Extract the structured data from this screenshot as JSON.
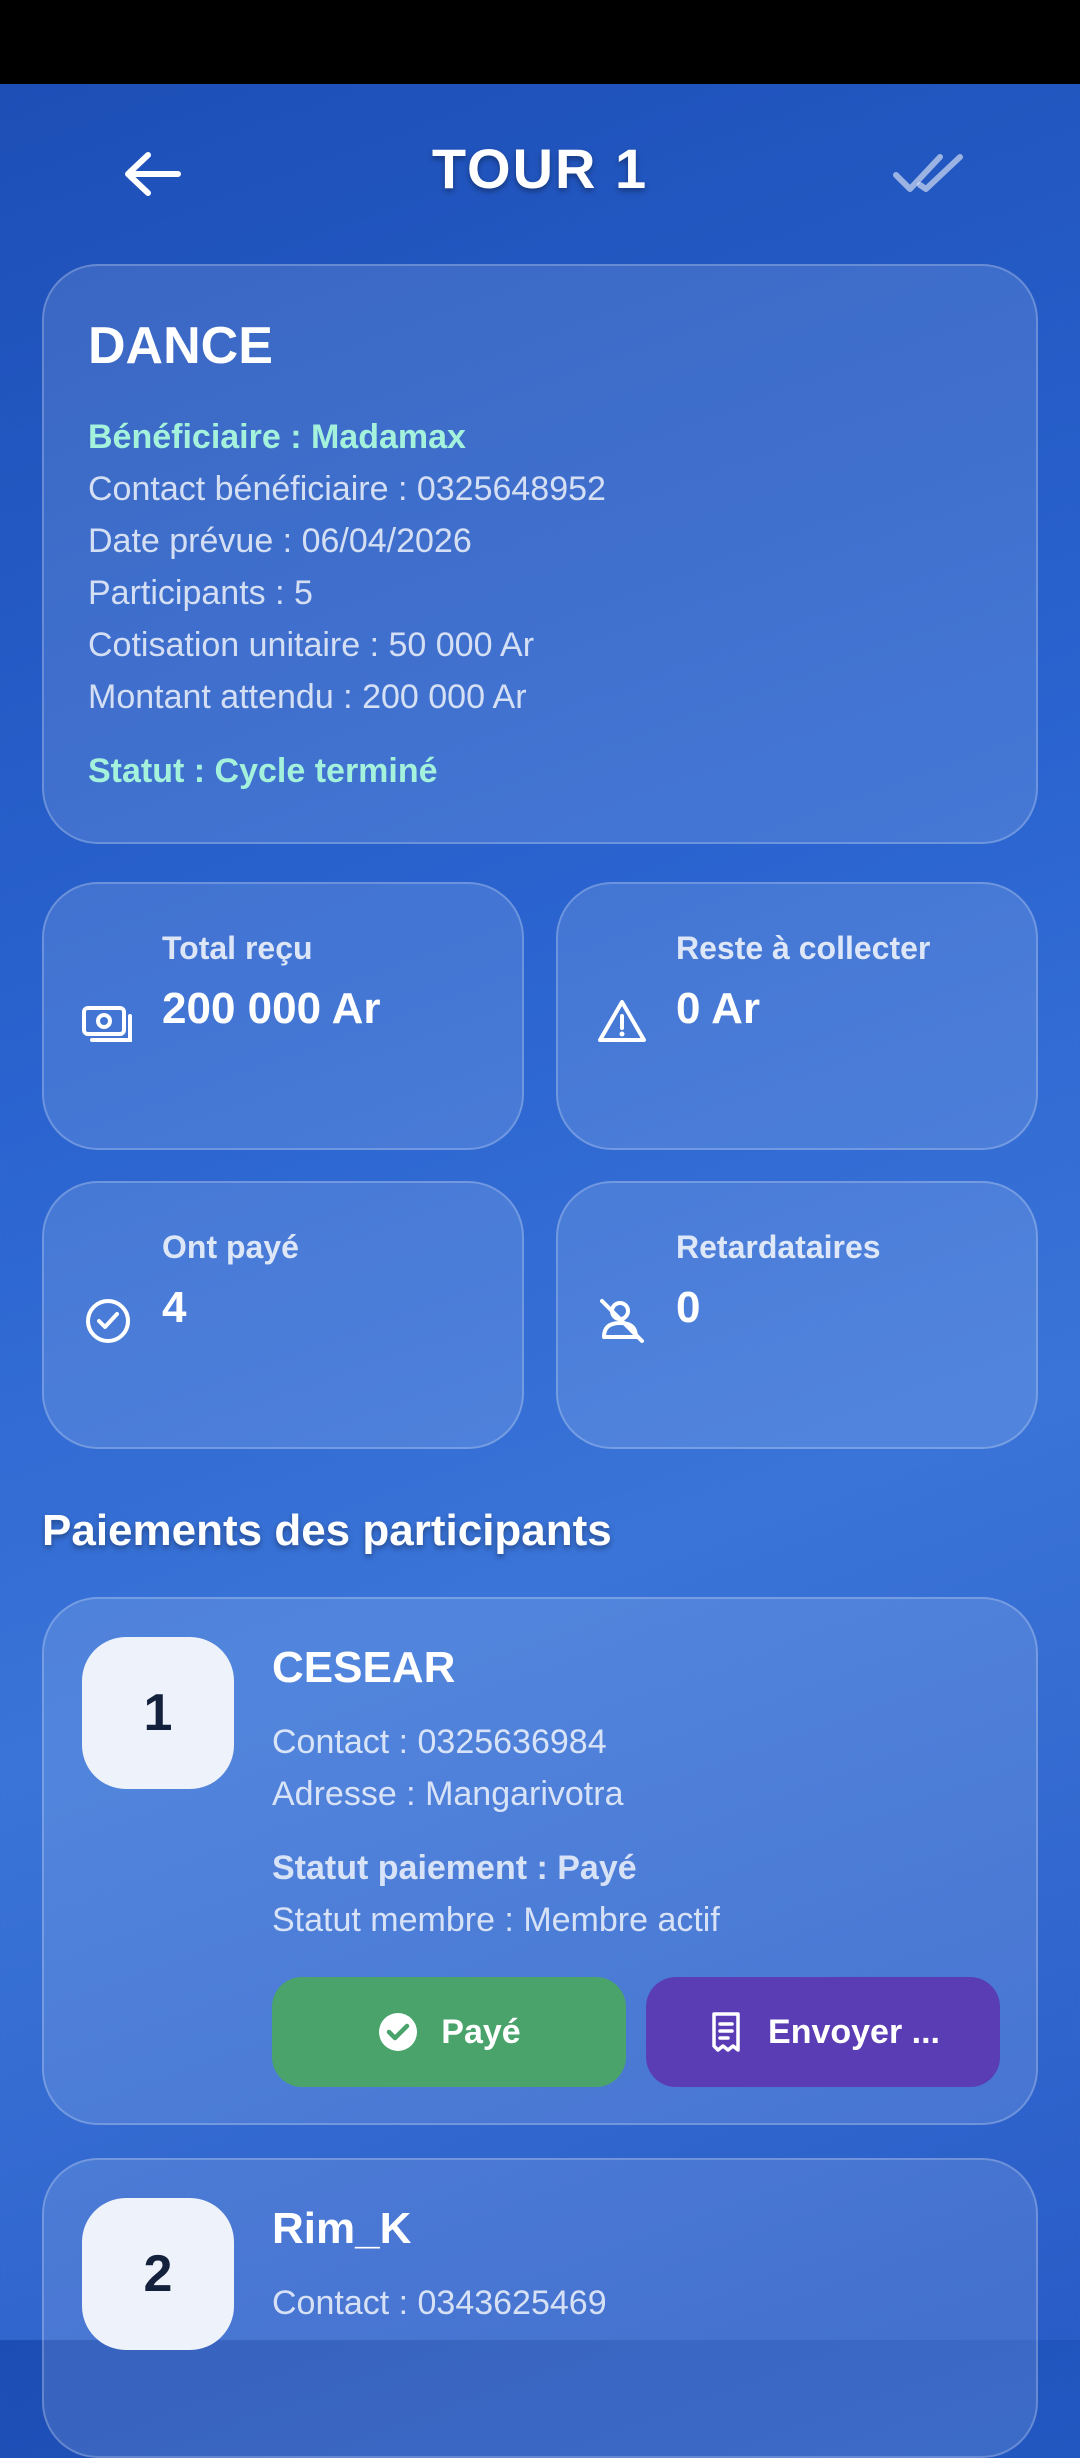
{
  "header": {
    "title": "TOUR 1"
  },
  "tour": {
    "name": "DANCE",
    "beneficiary": "Bénéficiaire : Madamax",
    "contact": "Contact bénéficiaire : 0325648952",
    "date": "Date prévue : 06/04/2026",
    "participants": "Participants : 5",
    "unit": "Cotisation unitaire : 50 000 Ar",
    "expected": "Montant attendu : 200 000 Ar",
    "status": "Statut : Cycle terminé"
  },
  "stats": [
    {
      "label": "Total reçu",
      "value": "200 000 Ar",
      "icon": "cash-icon"
    },
    {
      "label": "Reste à collecter",
      "value": "0 Ar",
      "icon": "warning-icon"
    },
    {
      "label": "Ont payé",
      "value": "4",
      "icon": "check-circle-icon"
    },
    {
      "label": "Retardataires",
      "value": "0",
      "icon": "person-off-icon"
    }
  ],
  "section": {
    "title": "Paiements des participants"
  },
  "payments": [
    {
      "rank": "1",
      "name": "CESEAR",
      "contact": "Contact : 0325636984",
      "address": "Adresse : Mangarivotra",
      "pay_status": "Statut paiement : Payé",
      "member_status": "Statut membre : Membre actif",
      "paid_label": "Payé",
      "send_label": "Envoyer ..."
    },
    {
      "rank": "2",
      "name": "Rim_K",
      "contact": "Contact : 0343625469"
    }
  ],
  "colors": {
    "accent": "#a4f2dc",
    "paid": "#4aa36b",
    "send": "#5a3db5"
  }
}
